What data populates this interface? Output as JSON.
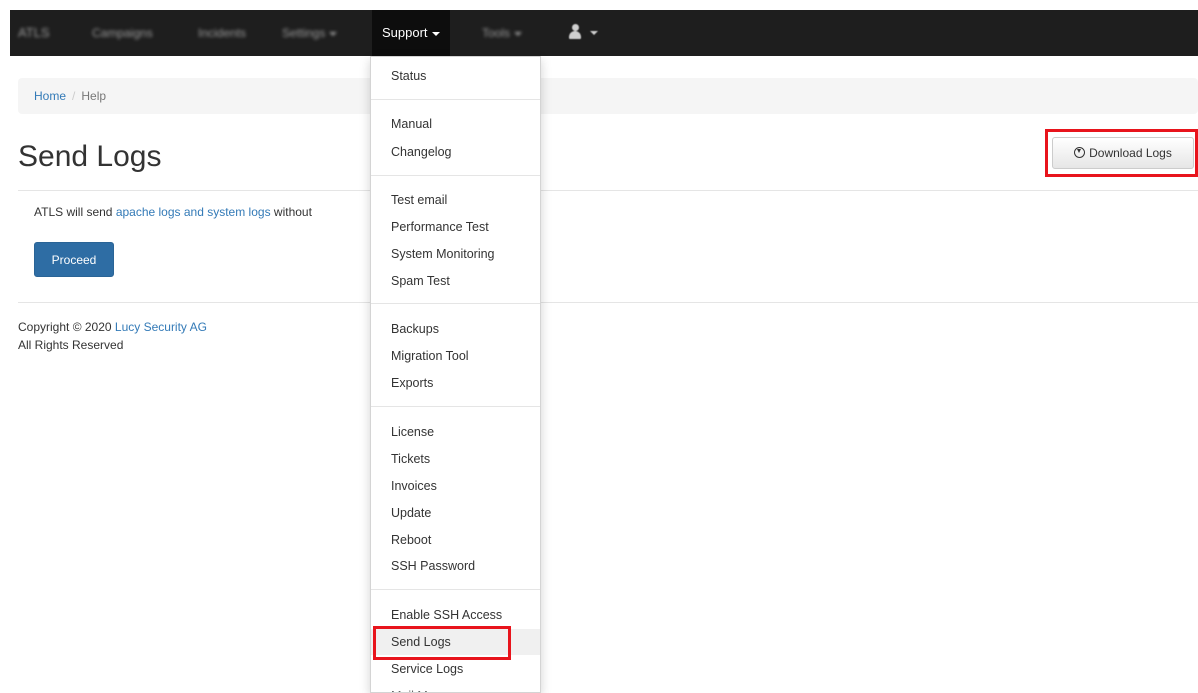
{
  "navbar": {
    "brand": "ATLS",
    "items": [
      {
        "label": "Campaigns"
      },
      {
        "label": "Incidents"
      },
      {
        "label": "Settings"
      },
      {
        "label": "Support"
      },
      {
        "label": "Tools"
      }
    ],
    "user_icon": "user-icon"
  },
  "breadcrumb": {
    "home": "Home",
    "separator": "/",
    "current": "Help"
  },
  "page": {
    "title": "Send Logs",
    "download_button": "Download Logs",
    "download_icon": "download-circle-icon",
    "info_prefix": "ATLS will send ",
    "info_link": "apache logs and system logs",
    "info_suffix": " without",
    "proceed_button": "Proceed"
  },
  "footer": {
    "copyright_prefix": "Copyright © 2020 ",
    "company": "Lucy Security AG",
    "rights": "All Rights Reserved"
  },
  "dropdown": {
    "items": [
      "Status",
      "Manual",
      "Changelog",
      "Test email",
      "Performance Test",
      "System Monitoring",
      "Spam Test",
      "Backups",
      "Migration Tool",
      "Exports",
      "License",
      "Tickets",
      "Invoices",
      "Update",
      "Reboot",
      "SSH Password",
      "Enable SSH Access",
      "Send Logs",
      "Service Logs",
      "Mail Manager"
    ],
    "active": "Send Logs"
  },
  "highlight_color": "#e8141c",
  "accent_color": "#337ab7"
}
